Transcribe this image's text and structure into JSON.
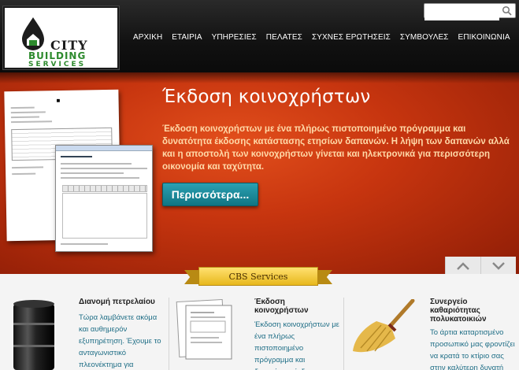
{
  "search": {
    "placeholder": ""
  },
  "logo": {
    "word1": "CITY",
    "word2": "BUILDING",
    "word3": "SERVICES"
  },
  "nav": [
    {
      "label": "ΑΡΧΙΚΗ"
    },
    {
      "label": "ΕΤΑΙΡΙΑ"
    },
    {
      "label": "ΥΠΗΡΕΣΙΕΣ"
    },
    {
      "label": "ΠΕΛΑΤΕΣ"
    },
    {
      "label": "ΣΥΧΝΕΣ ΕΡΩΤΗΣΕΙΣ"
    },
    {
      "label": "ΣΥΜΒΟΥΛΕΣ"
    },
    {
      "label": "ΕΠΙΚΟΙΝΩΝΙΑ"
    }
  ],
  "hero": {
    "title": "Έκδοση κοινοχρήστων",
    "description": "Έκδοση κοινοχρήστων με ένα πλήρως πιστοποιημένο πρόγραμμα και δυνατότητα έκδοσης κατάστασης ετησίων δαπανών. Η λήψη των δαπανών αλλά και η αποστολή των κοινοχρήστων γίνεται και ηλεκτρονικά για περισσότερη οικονομία και ταχύτητα.",
    "button": "Περισσότερα..."
  },
  "section": {
    "ribbon": "CBS Services"
  },
  "services": [
    {
      "title": "Διανομή πετρελαίου",
      "text": "Τώρα λαμβάνετε ακόμα και αυθημερόν εξυπηρέτηση. Έχουμε το ανταγωνιστικό πλεονέκτημα για"
    },
    {
      "title": "Έκδοση κοινοχρήστων",
      "text": "Έκδοση κοινοχρήστων με ένα πλήρως πιστοποιημένο πρόγραμμα και δυνατότητα έκδοσης"
    },
    {
      "title": "Συνεργείο καθαριότητας πολυκατοικιών",
      "text": "Το άρτια καταρτισμένο προσωπικό μας φροντίζει να κρατά το κτίριο σας στην καλύτερη δυνατή"
    }
  ],
  "colors": {
    "accent": "#117583",
    "hero": "#c7350f",
    "link_text": "#1f6e86",
    "ribbon": "#e7b81c"
  }
}
